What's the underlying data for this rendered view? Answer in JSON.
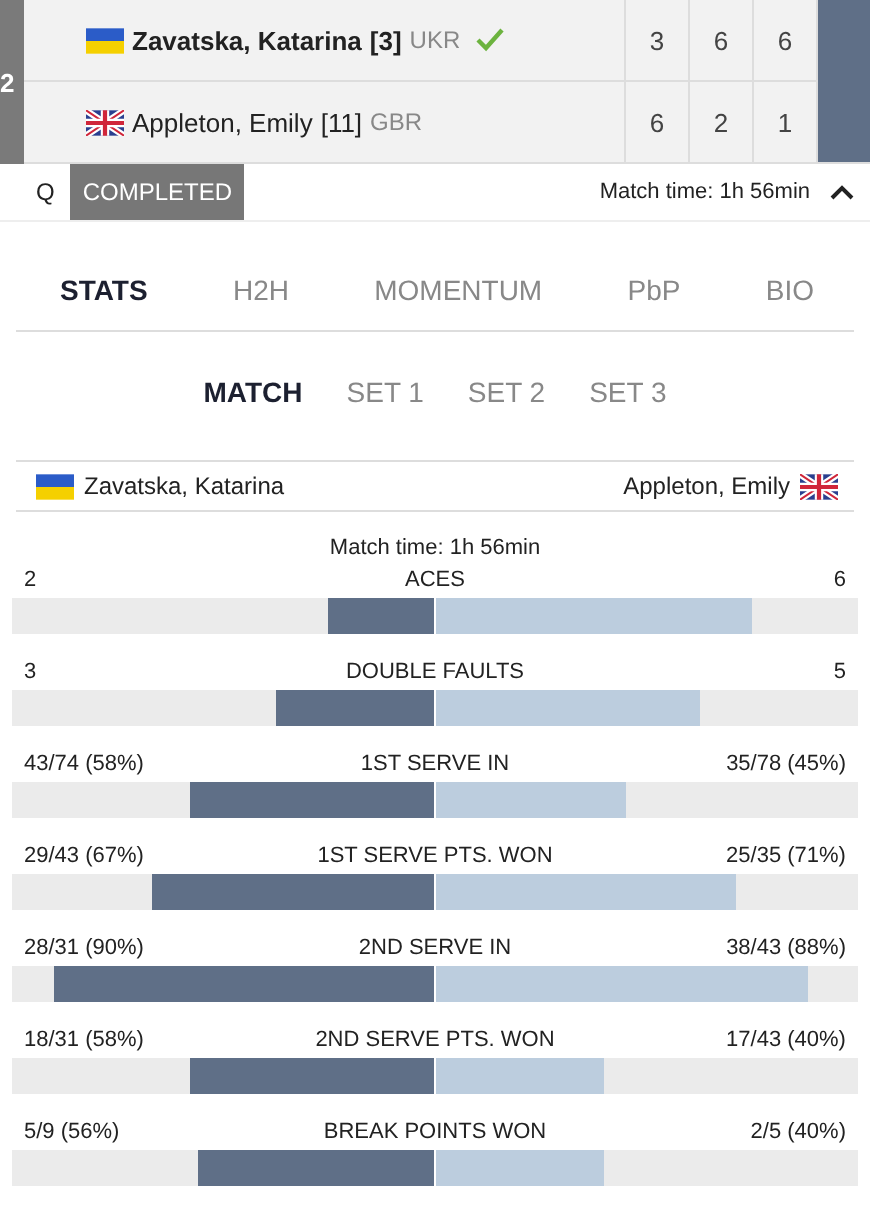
{
  "scoreboard": {
    "round": "2",
    "players": [
      {
        "name": "Zavatska, Katarina",
        "seed": "[3]",
        "country": "UKR",
        "winner": true,
        "sets": [
          "3",
          "6",
          "6"
        ]
      },
      {
        "name": "Appleton, Emily",
        "seed": "[11]",
        "country": "GBR",
        "winner": false,
        "sets": [
          "6",
          "2",
          "1"
        ]
      }
    ],
    "qualifier": "Q",
    "status": "COMPLETED",
    "match_time": "Match time: 1h 56min",
    "expanded": true
  },
  "tabs": [
    {
      "label": "STATS",
      "selected": true
    },
    {
      "label": "H2H",
      "selected": false
    },
    {
      "label": "MOMENTUM",
      "selected": false
    },
    {
      "label": "PbP",
      "selected": false
    },
    {
      "label": "BIO",
      "selected": false
    }
  ],
  "sub_tabs": [
    {
      "label": "MATCH",
      "selected": true
    },
    {
      "label": "SET 1",
      "selected": false
    },
    {
      "label": "SET 2",
      "selected": false
    },
    {
      "label": "SET 3",
      "selected": false
    }
  ],
  "players_header": {
    "left": "Zavatska, Katarina",
    "right": "Appleton, Emily"
  },
  "match_time": "Match time: 1h 56min",
  "stats": [
    {
      "label": "ACES",
      "left": {
        "value": "2",
        "level": 0.25
      },
      "right": {
        "value": "6",
        "level": 0.75
      }
    },
    {
      "label": "DOUBLE FAULTS",
      "left": {
        "value": "3",
        "level": 0.375
      },
      "right": {
        "value": "5",
        "level": 0.625
      }
    },
    {
      "label": "1ST SERVE IN",
      "left": {
        "value": "43/74 (58%)",
        "level": 0.58
      },
      "right": {
        "value": "35/78 (45%)",
        "level": 0.45
      }
    },
    {
      "label": "1ST SERVE PTS. WON",
      "left": {
        "value": "29/43 (67%)",
        "level": 0.67
      },
      "right": {
        "value": "25/35 (71%)",
        "level": 0.71
      }
    },
    {
      "label": "2ND SERVE IN",
      "left": {
        "value": "28/31 (90%)",
        "level": 0.9
      },
      "right": {
        "value": "38/43 (88%)",
        "level": 0.88
      }
    },
    {
      "label": "2ND SERVE PTS. WON",
      "left": {
        "value": "18/31 (58%)",
        "level": 0.58
      },
      "right": {
        "value": "17/43 (40%)",
        "level": 0.4
      }
    },
    {
      "label": "BREAK POINTS WON",
      "left": {
        "value": "5/9 (56%)",
        "level": 0.56
      },
      "right": {
        "value": "2/5 (40%)",
        "level": 0.4
      }
    }
  ]
}
